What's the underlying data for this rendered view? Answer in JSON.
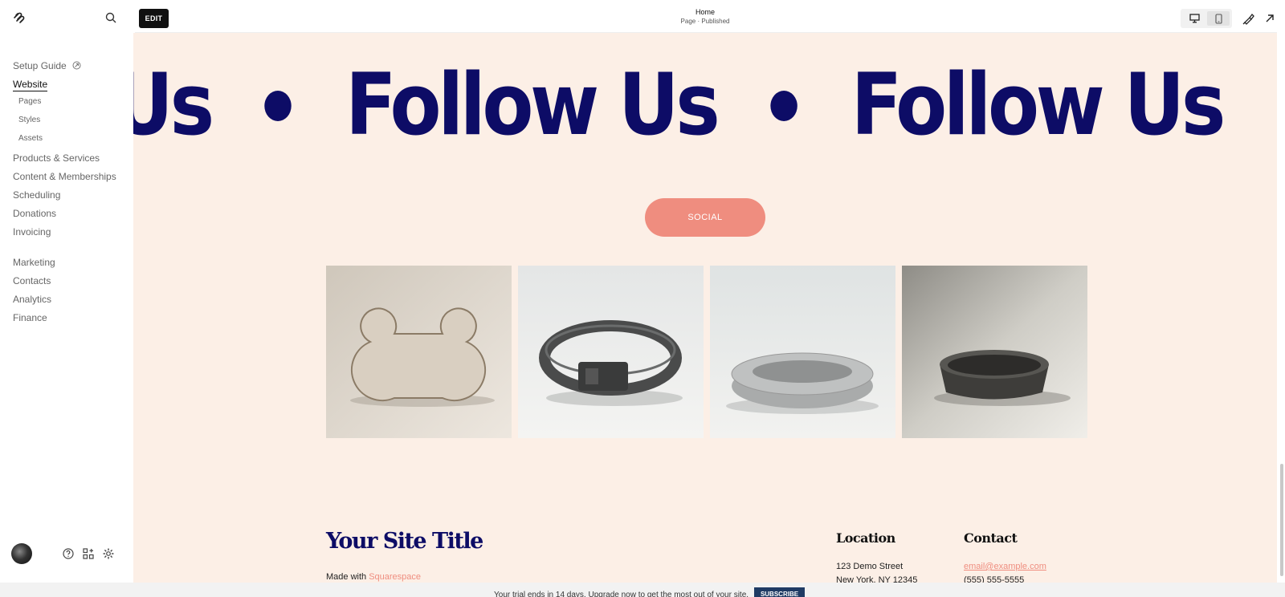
{
  "sidebar": {
    "nav": {
      "setup_guide": "Setup Guide",
      "website": "Website",
      "pages": "Pages",
      "styles": "Styles",
      "assets": "Assets",
      "products": "Products & Services",
      "content": "Content & Memberships",
      "scheduling": "Scheduling",
      "donations": "Donations",
      "invoicing": "Invoicing",
      "marketing": "Marketing",
      "contacts": "Contacts",
      "analytics": "Analytics",
      "finance": "Finance"
    }
  },
  "topbar": {
    "edit_label": "EDIT",
    "page_title": "Home",
    "page_status": "Page · Published"
  },
  "preview": {
    "marquee_text": "Follow Us",
    "social_label": "SOCIAL",
    "gallery": [
      {
        "alt": "bone toy"
      },
      {
        "alt": "dog collar"
      },
      {
        "alt": "dog bed"
      },
      {
        "alt": "dog bowl"
      }
    ],
    "footer": {
      "site_title": "Your Site Title",
      "made_with": "Made with",
      "made_with_link": "Squarespace",
      "location_heading": "Location",
      "address_line1": "123 Demo Street",
      "address_line2": "New York, NY 12345",
      "contact_heading": "Contact",
      "email": "email@example.com",
      "phone": "(555) 555-5555"
    }
  },
  "trial_bar": {
    "message": "Your trial ends in 14 days. Upgrade now to get the most out of your site.",
    "subscribe_label": "SUBSCRIBE"
  },
  "colors": {
    "accent": "#ef8d7f",
    "navy": "#0d0c66",
    "preview_bg": "#fcefe6",
    "subscribe_bg": "#1f3b64"
  }
}
